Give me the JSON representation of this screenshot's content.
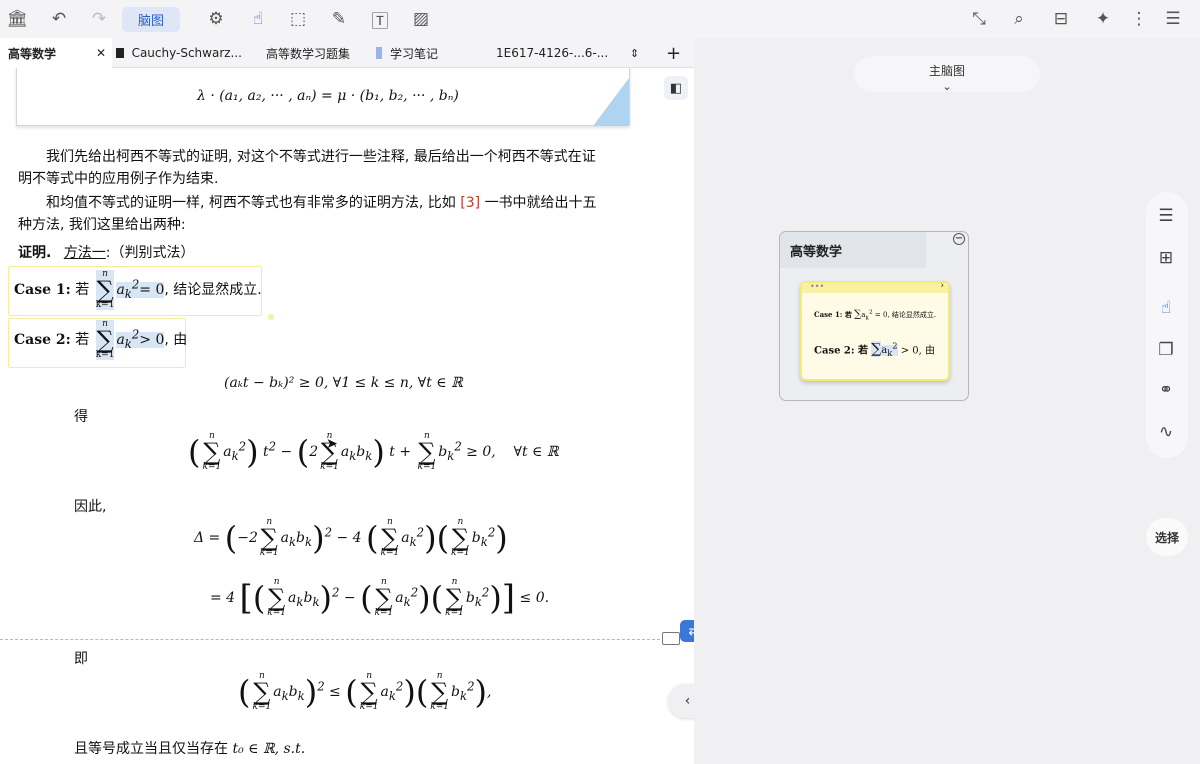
{
  "toolbar": {
    "mindmap_label": "脑图"
  },
  "tabs": [
    {
      "label": "高等数学"
    },
    {
      "label": "Cauchy-Schwarz..."
    },
    {
      "label": "高等数学习题集"
    },
    {
      "label": "学习笔记"
    },
    {
      "label": "1E617-4126-...6-..."
    }
  ],
  "doc": {
    "eq_top": "λ · (a₁, a₂, ··· , aₙ) = μ · (b₁, b₂, ··· , bₙ)",
    "p1a": "我们先给出柯西不等式的证明, 对这个不等式进行一些注释, 最后给出一个柯西不等式在证",
    "p1b": "明不等式中的应用例子作为结束.",
    "p2a_pre": "和均值不等式的证明一样, 柯西不等式也有非常多的证明方法, 比如",
    "p2a_ref": "[3]",
    "p2a_post": "一书中就给出十五",
    "p2b": "种方法, 我们这里给出两种:",
    "proof_label": "证明.",
    "method": "方法一",
    "method_suffix": ":（判别式法）",
    "case1_label": "Case 1:",
    "case1_if": "若",
    "case1_eq": "= 0",
    "case1_tail": ", 结论显然成立.",
    "case2_label": "Case 2:",
    "case2_if": "若",
    "case2_eq": "> 0",
    "case2_tail": ", 由",
    "eq1": "(aₖt − bₖ)² ≥ 0,   ∀1 ≤ k ≤ n,   ∀t ∈ ℝ",
    "de": "得",
    "yinci": "因此,",
    "ji": "即",
    "last": "且等号成立当且仅当存在",
    "last_math": "t₀ ∈ ℝ, s.t."
  },
  "right": {
    "main_mindmap": "主脑图",
    "node_title": "高等数学",
    "card_case1": "Case 1: 若",
    "card_case1_tail": "= 0, 结论显然成立.",
    "card_case2": "Case 2: 若",
    "card_case2_tail": "> 0, 由",
    "select_label": "选择"
  }
}
